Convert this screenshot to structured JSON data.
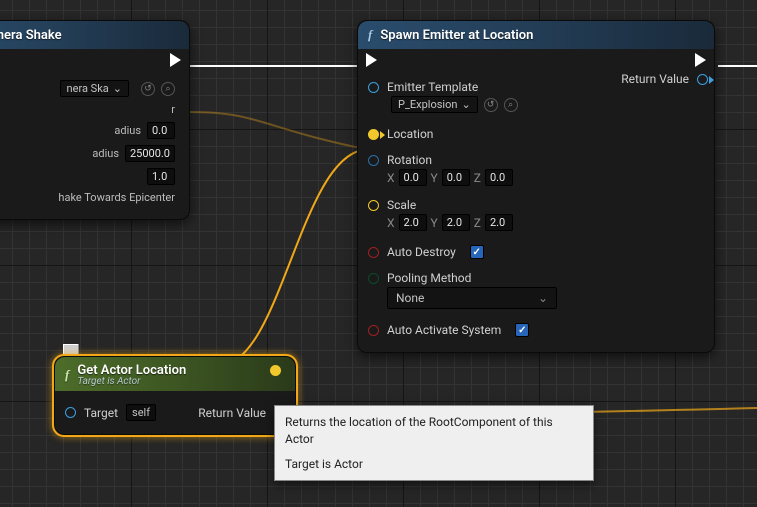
{
  "node_camerashake": {
    "title_visible": "ld Camera Shake",
    "emitter_dropdown": "nera Ska",
    "row_r": "r",
    "row_radius1_label": "adius",
    "row_radius1_value": "0.0",
    "row_radius2_label": "adius",
    "row_radius2_value": "25000.0",
    "row_value": "1.0",
    "row_shake": "hake Towards Epicenter"
  },
  "node_getactor": {
    "title": "Get Actor Location",
    "subtitle": "Target is Actor",
    "target_label": "Target",
    "target_value": "self",
    "return_label": "Return Value"
  },
  "node_spawnemitter": {
    "title": "Spawn Emitter at Location",
    "emitter_template_label": "Emitter Template",
    "emitter_template_value": "P_Explosion",
    "return_value_label": "Return Value",
    "location_label": "Location",
    "rotation_label": "Rotation",
    "scale_label": "Scale",
    "rot": {
      "x": "0.0",
      "y": "0.0",
      "z": "0.0"
    },
    "scale": {
      "x": "2.0",
      "y": "2.0",
      "z": "2.0"
    },
    "auto_destroy_label": "Auto Destroy",
    "pooling_label": "Pooling Method",
    "pooling_value": "None",
    "auto_activate_label": "Auto Activate System",
    "axis": {
      "x": "X",
      "y": "Y",
      "z": "Z"
    }
  },
  "tooltip": {
    "line1": "Returns the location of the RootComponent of this Actor",
    "line2": "Target is Actor"
  },
  "icons": {
    "reset": "↺",
    "search": "⌕",
    "chevron_down": "⌄"
  }
}
